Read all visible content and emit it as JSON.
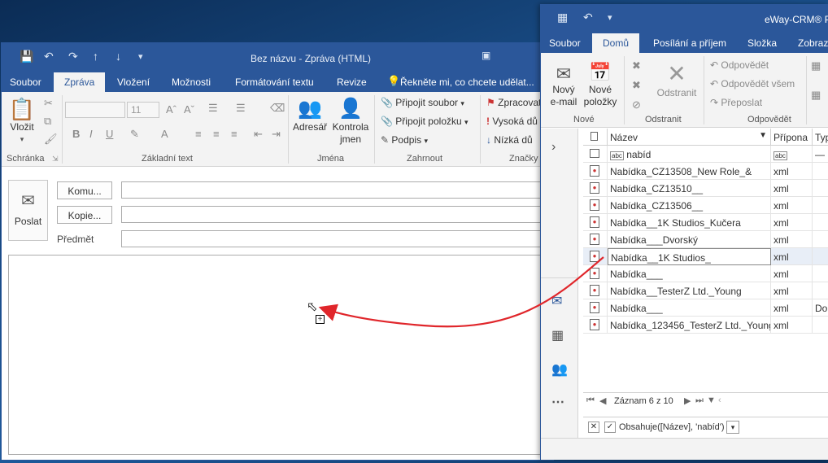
{
  "outlook": {
    "title": "Bez názvu - Zpráva (HTML)",
    "tabs": [
      "Soubor",
      "Zpráva",
      "Vložení",
      "Možnosti",
      "Formátování textu",
      "Revize"
    ],
    "tellme": "Řekněte mi, co chcete udělat...",
    "ribbon": {
      "paste_label": "Vložit",
      "font_size": "11",
      "address_book": "Adresář",
      "check_names_1": "Kontrola",
      "check_names_2": "jmen",
      "attach_file": "Připojit soubor",
      "attach_item": "Připojit položku",
      "signature": "Podpis",
      "follow_up": "Zpracovat",
      "high_importance": "Vysoká dů",
      "low_importance": "Nízká dů",
      "groups": {
        "clipboard": "Schránka",
        "basic_text": "Základní text",
        "names": "Jména",
        "include": "Zahrnout",
        "tags": "Značky"
      },
      "format_letters": {
        "bold": "B",
        "italic": "I",
        "underline": "U",
        "font_color": "A"
      }
    },
    "compose": {
      "send": "Poslat",
      "to": "Komu...",
      "cc": "Kopie...",
      "subject": "Předmět"
    }
  },
  "crm": {
    "title": "eWay-CRM® P",
    "tabs": [
      "Soubor",
      "Domů",
      "Posílání a příjem",
      "Složka",
      "Zobraz"
    ],
    "ribbon": {
      "new_email_1": "Nový",
      "new_email_2": "e-mail",
      "new_items_1": "Nové",
      "new_items_2": "položky",
      "delete": "Odstranit",
      "reply": "Odpovědět",
      "reply_all": "Odpovědět všem",
      "forward": "Přeposlat",
      "groups": {
        "new": "Nové",
        "delete": "Odstranit",
        "respond": "Odpovědět"
      }
    },
    "grid": {
      "headers": [
        "Název",
        "Přípona",
        "Typ"
      ],
      "filter_name": "nabíd",
      "filter_ext": "",
      "rows": [
        {
          "name": "Nabídka_CZ13508_New Role_&",
          "ext": "xml",
          "type": ""
        },
        {
          "name": "Nabídka_CZ13510__",
          "ext": "xml",
          "type": ""
        },
        {
          "name": "Nabídka_CZ13506__",
          "ext": "xml",
          "type": ""
        },
        {
          "name": "Nabídka__1K Studios_Kučera",
          "ext": "xml",
          "type": ""
        },
        {
          "name": "Nabídka___Dvorský",
          "ext": "xml",
          "type": ""
        },
        {
          "name": "Nabídka__1K Studios_",
          "ext": "xml",
          "type": "",
          "selected": true
        },
        {
          "name": "Nabídka___",
          "ext": "xml",
          "type": ""
        },
        {
          "name": "Nabídka__TesterZ Ltd._Young",
          "ext": "xml",
          "type": ""
        },
        {
          "name": "Nabídka___",
          "ext": "xml",
          "type": "Dok"
        },
        {
          "name": "Nabídka_123456_TesterZ Ltd._Young",
          "ext": "xml",
          "type": ""
        }
      ]
    },
    "pager": "Záznam 6 z 10",
    "filter_text": "Obsahuje([Název], 'nabíd')"
  },
  "colors": {
    "accent": "#2b579a",
    "arrow": "#e0262b"
  }
}
